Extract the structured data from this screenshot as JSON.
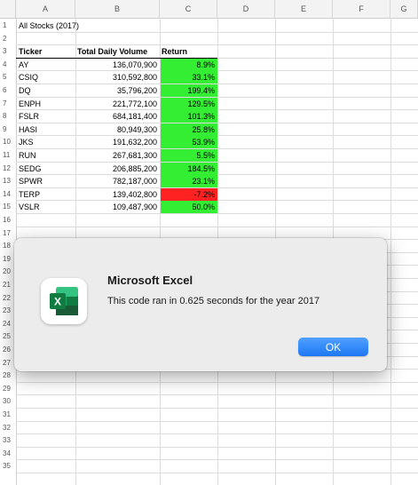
{
  "columns": [
    "A",
    "B",
    "C",
    "D",
    "E",
    "F",
    "G"
  ],
  "rows": [
    "1",
    "2",
    "3",
    "4",
    "5",
    "6",
    "7",
    "8",
    "9",
    "10",
    "11",
    "12",
    "13",
    "14",
    "15",
    "16",
    "17",
    "18",
    "19",
    "20",
    "21",
    "22",
    "23",
    "24",
    "25",
    "26",
    "27",
    "28",
    "29",
    "30",
    "31",
    "32",
    "33",
    "34",
    "35"
  ],
  "sheet_title": "All Stocks (2017)",
  "table": {
    "headers": [
      "Ticker",
      "Total Daily Volume",
      "Return"
    ],
    "rows": [
      {
        "ticker": "AY",
        "volume": "136,070,900",
        "return": "8.9%",
        "color": "#33ee33"
      },
      {
        "ticker": "CSIQ",
        "volume": "310,592,800",
        "return": "33.1%",
        "color": "#33ee33"
      },
      {
        "ticker": "DQ",
        "volume": "35,796,200",
        "return": "199.4%",
        "color": "#33ee33"
      },
      {
        "ticker": "ENPH",
        "volume": "221,772,100",
        "return": "129.5%",
        "color": "#33ee33"
      },
      {
        "ticker": "FSLR",
        "volume": "684,181,400",
        "return": "101.3%",
        "color": "#33ee33"
      },
      {
        "ticker": "HASI",
        "volume": "80,949,300",
        "return": "25.8%",
        "color": "#33ee33"
      },
      {
        "ticker": "JKS",
        "volume": "191,632,200",
        "return": "53.9%",
        "color": "#33ee33"
      },
      {
        "ticker": "RUN",
        "volume": "267,681,300",
        "return": "5.5%",
        "color": "#33ee33"
      },
      {
        "ticker": "SEDG",
        "volume": "206,885,200",
        "return": "184.5%",
        "color": "#33ee33"
      },
      {
        "ticker": "SPWR",
        "volume": "782,187,000",
        "return": "23.1%",
        "color": "#33ee33"
      },
      {
        "ticker": "TERP",
        "volume": "139,402,800",
        "return": "-7.2%",
        "color": "#ff2222"
      },
      {
        "ticker": "VSLR",
        "volume": "109,487,900",
        "return": "50.0%",
        "color": "#33ee33"
      }
    ]
  },
  "dialog": {
    "title": "Microsoft Excel",
    "message": "This code ran in 0.625 seconds for the year 2017",
    "ok_label": "OK",
    "icon_letter": "X",
    "icon_color": "#1f7a43"
  }
}
